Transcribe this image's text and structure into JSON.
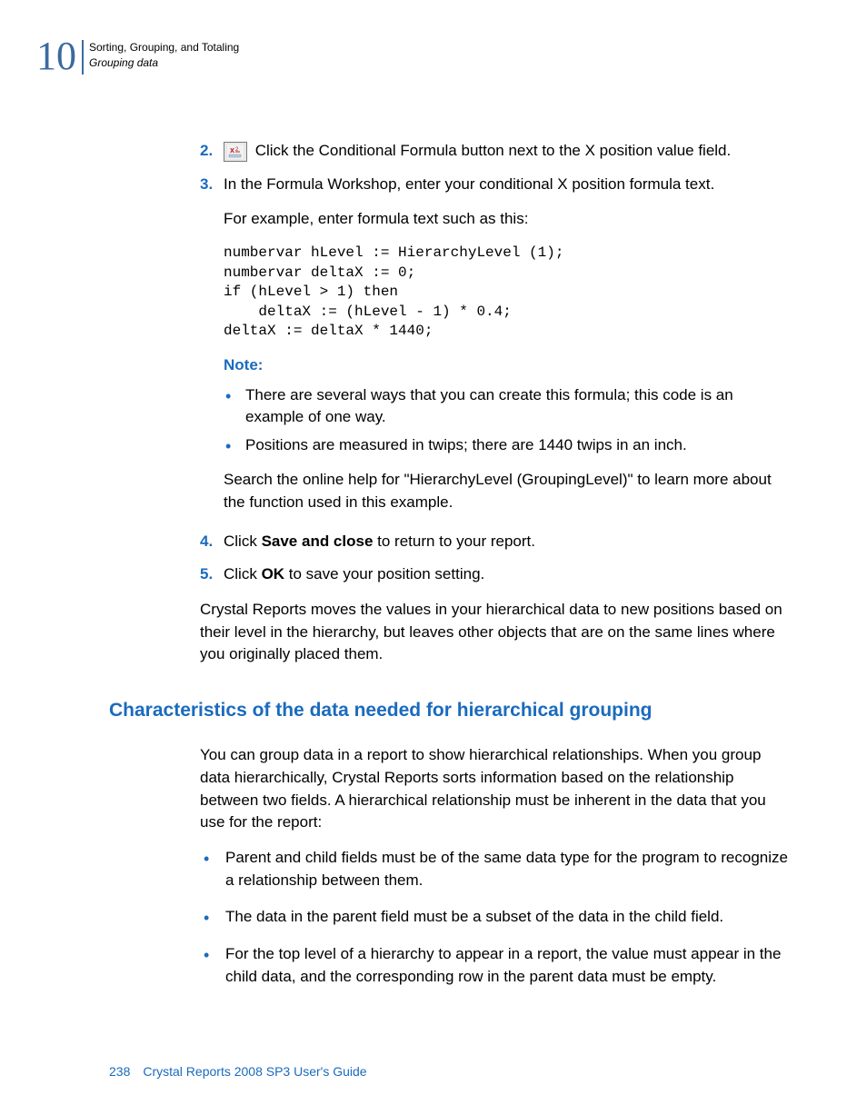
{
  "header": {
    "chapter_number": "10",
    "title_line1": "Sorting, Grouping, and Totaling",
    "title_line2": "Grouping data"
  },
  "steps": {
    "s2": {
      "num": "2.",
      "icon_name": "conditional-formula-icon",
      "text_after_icon": " Click the Conditional Formula button next to the X position value field."
    },
    "s3": {
      "num": "3.",
      "text": "In the Formula Workshop, enter your conditional X position formula text.",
      "example_intro": "For example, enter formula text such as this:",
      "code": "numbervar hLevel := HierarchyLevel (1);\nnumbervar deltaX := 0;\nif (hLevel > 1) then\n    deltaX := (hLevel - 1) * 0.4;\ndeltaX := deltaX * 1440;",
      "note_label": "Note:",
      "note_bullets": [
        "There are several ways that you can create this formula; this code is an example of one way.",
        "Positions are measured in twips; there are 1440 twips in an inch."
      ],
      "note_followup": "Search the online help for \"HierarchyLevel (GroupingLevel)\" to learn more about the function used in this example."
    },
    "s4": {
      "num": "4.",
      "pre": "Click ",
      "bold": "Save and close",
      "post": " to return to your report."
    },
    "s5": {
      "num": "5.",
      "pre": "Click ",
      "bold": "OK",
      "post": " to save your position setting."
    }
  },
  "closing_para": "Crystal Reports moves the values in your hierarchical data to new positions based on their level in the hierarchy, but leaves other objects that are on the same lines where you originally placed them.",
  "section": {
    "heading": "Characteristics of the data needed for hierarchical grouping",
    "intro": "You can group data in a report to show hierarchical relationships. When you group data hierarchically, Crystal Reports sorts information based on the relationship between two fields. A hierarchical relationship must be inherent in the data that you use for the report:",
    "bullets": [
      "Parent and child fields must be of the same data type for the program to recognize a relationship between them.",
      "The data in the parent field must be a subset of the data in the child field.",
      "For the top level of a hierarchy to appear in a report, the value must appear in the child data, and the corresponding row in the parent data must be empty."
    ]
  },
  "footer": {
    "page_number": "238",
    "doc_title": "Crystal Reports 2008 SP3 User's Guide"
  }
}
